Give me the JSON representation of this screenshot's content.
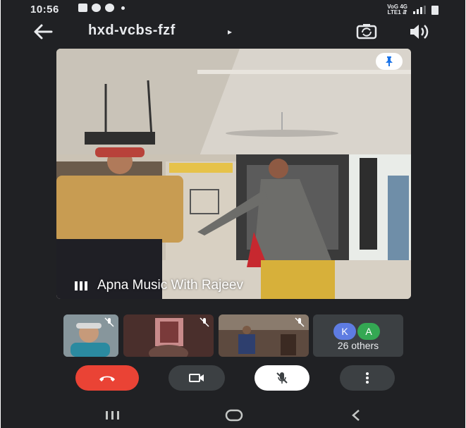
{
  "status_bar": {
    "time": "10:56",
    "network_top": "VoG 4G",
    "network_bottom": "LTE1 ⇵"
  },
  "top_bar": {
    "meeting_code": "hxd-vcbs-fzf",
    "caret": "▸"
  },
  "main_video": {
    "speaker_name": "Apna Music With Rajeev"
  },
  "participants": {
    "avatars": [
      {
        "initial": "K",
        "color": "#5e7ce2"
      },
      {
        "initial": "A",
        "color": "#34a853"
      }
    ],
    "others_label": "26 others"
  },
  "colors": {
    "background": "#202124",
    "end_call": "#ea4335",
    "control": "#3c4043"
  },
  "icons": {
    "back": "arrow-left-icon",
    "switch_camera": "switch-camera-icon",
    "speaker": "speaker-icon",
    "pin": "pin-icon",
    "end_call": "phone-hangup-icon",
    "camera": "video-camera-icon",
    "mic": "mic-off-icon",
    "more": "more-vertical-icon"
  }
}
